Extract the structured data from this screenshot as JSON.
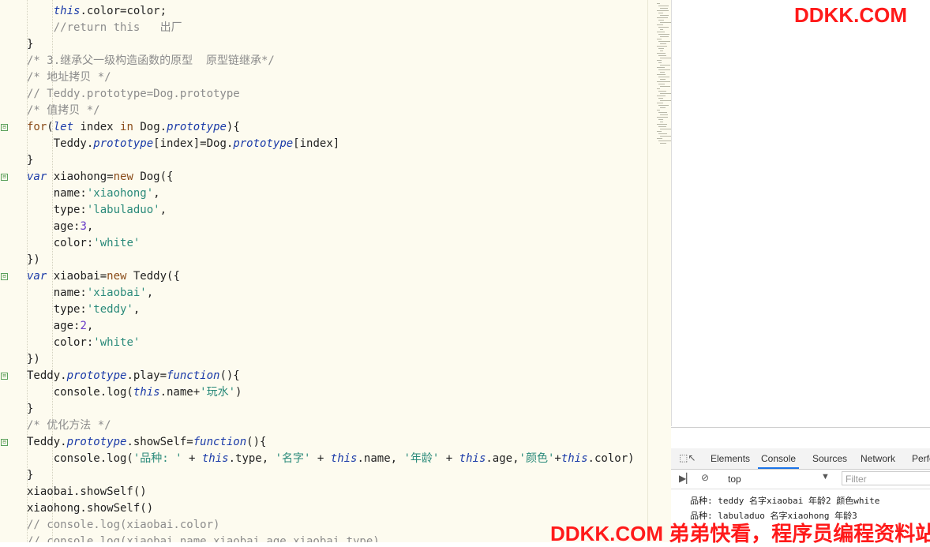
{
  "editor": {
    "lines": [
      {
        "t": [
          [
            "    ",
            ""
          ],
          [
            "this",
            "it"
          ],
          [
            ".color=color;",
            ""
          ]
        ]
      },
      {
        "t": [
          [
            "    ",
            ""
          ],
          [
            "//return this   出厂",
            "cm"
          ]
        ]
      },
      {
        "t": [
          [
            "}",
            ""
          ]
        ]
      },
      {
        "t": [
          [
            "/* 3.继承父一级构造函数的原型  原型链继承*/",
            "cm"
          ]
        ]
      },
      {
        "t": [
          [
            "/* 地址拷贝 */",
            "cm"
          ]
        ]
      },
      {
        "t": [
          [
            "// Teddy.prototype=Dog.prototype",
            "cm"
          ]
        ]
      },
      {
        "t": [
          [
            "/* 值拷贝 */",
            "cm"
          ]
        ]
      },
      {
        "t": [
          [
            "for",
            "kw"
          ],
          [
            "(",
            ""
          ],
          [
            "let",
            "it"
          ],
          [
            " index ",
            ""
          ],
          [
            "in",
            "kw"
          ],
          [
            " Dog.",
            ""
          ],
          [
            "prototype",
            "it"
          ],
          [
            "){",
            ""
          ]
        ]
      },
      {
        "t": [
          [
            "    Teddy.",
            ""
          ],
          [
            "prototype",
            "it"
          ],
          [
            "[index]=Dog.",
            ""
          ],
          [
            "prototype",
            "it"
          ],
          [
            "[index]",
            ""
          ]
        ]
      },
      {
        "t": [
          [
            "}",
            ""
          ]
        ]
      },
      {
        "t": [
          [
            "var",
            "it"
          ],
          [
            " xiaohong=",
            ""
          ],
          [
            "new",
            "kw"
          ],
          [
            " Dog({",
            ""
          ]
        ]
      },
      {
        "t": [
          [
            "    name:",
            ""
          ],
          [
            "'xiaohong'",
            "str"
          ],
          [
            ",",
            ""
          ]
        ]
      },
      {
        "t": [
          [
            "    type:",
            ""
          ],
          [
            "'labuladuo'",
            "str"
          ],
          [
            ",",
            ""
          ]
        ]
      },
      {
        "t": [
          [
            "    age:",
            ""
          ],
          [
            "3",
            "num"
          ],
          [
            ",",
            ""
          ]
        ]
      },
      {
        "t": [
          [
            "    color:",
            ""
          ],
          [
            "'white'",
            "str"
          ]
        ]
      },
      {
        "t": [
          [
            "})",
            ""
          ]
        ]
      },
      {
        "t": [
          [
            "var",
            "it"
          ],
          [
            " xiaobai=",
            ""
          ],
          [
            "new",
            "kw"
          ],
          [
            " Teddy({",
            ""
          ]
        ]
      },
      {
        "t": [
          [
            "    name:",
            ""
          ],
          [
            "'xiaobai'",
            "str"
          ],
          [
            ",",
            ""
          ]
        ]
      },
      {
        "t": [
          [
            "    type:",
            ""
          ],
          [
            "'teddy'",
            "str"
          ],
          [
            ",",
            ""
          ]
        ]
      },
      {
        "t": [
          [
            "    age:",
            ""
          ],
          [
            "2",
            "num"
          ],
          [
            ",",
            ""
          ]
        ]
      },
      {
        "t": [
          [
            "    color:",
            ""
          ],
          [
            "'white'",
            "str"
          ]
        ]
      },
      {
        "t": [
          [
            "})",
            ""
          ]
        ]
      },
      {
        "t": [
          [
            "Teddy.",
            ""
          ],
          [
            "prototype",
            "it"
          ],
          [
            ".play=",
            ""
          ],
          [
            "function",
            "it"
          ],
          [
            "(){",
            ""
          ]
        ]
      },
      {
        "t": [
          [
            "    console.log(",
            ""
          ],
          [
            "this",
            "it"
          ],
          [
            ".name+",
            ""
          ],
          [
            "'玩水'",
            "str"
          ],
          [
            ")",
            ""
          ]
        ]
      },
      {
        "t": [
          [
            "}",
            ""
          ]
        ]
      },
      {
        "t": [
          [
            "/* 优化方法 */",
            "cm"
          ]
        ]
      },
      {
        "t": [
          [
            "Teddy.",
            ""
          ],
          [
            "prototype",
            "it"
          ],
          [
            ".showSelf=",
            ""
          ],
          [
            "function",
            "it"
          ],
          [
            "(){",
            ""
          ]
        ]
      },
      {
        "t": [
          [
            "    console.log(",
            ""
          ],
          [
            "'品种: '",
            "str"
          ],
          [
            " + ",
            ""
          ],
          [
            "this",
            "it"
          ],
          [
            ".type, ",
            ""
          ],
          [
            "'名字'",
            "str"
          ],
          [
            " + ",
            ""
          ],
          [
            "this",
            "it"
          ],
          [
            ".name, ",
            ""
          ],
          [
            "'年龄'",
            "str"
          ],
          [
            " + ",
            ""
          ],
          [
            "this",
            "it"
          ],
          [
            ".age,",
            ""
          ],
          [
            "'颜色'",
            "str"
          ],
          [
            "+",
            ""
          ],
          [
            "this",
            "it"
          ],
          [
            ".color)",
            ""
          ]
        ]
      },
      {
        "t": [
          [
            "}",
            ""
          ]
        ]
      },
      {
        "t": [
          [
            "xiaobai.showSelf()",
            ""
          ]
        ]
      },
      {
        "t": [
          [
            "xiaohong.showSelf()",
            ""
          ]
        ]
      },
      {
        "t": [
          [
            "// console.log(xiaobai.color)",
            "cm"
          ]
        ]
      },
      {
        "t": [
          [
            "// console.log(xiaobai.name,xiaobai.age,xiaobai.type)",
            "cm"
          ]
        ]
      }
    ],
    "fold_markers": [
      "⊟",
      "⊟",
      "⊟",
      "⊟",
      "⊟"
    ]
  },
  "watermark_top": "DDKK.COM",
  "watermark_bottom": "DDKK.COM 弟弟快看，程序员编程资料站",
  "devtools": {
    "tabs": [
      "Elements",
      "Console",
      "Sources",
      "Network",
      "Perfo"
    ],
    "active_tab": "Console",
    "context": "top",
    "filter_placeholder": "Filter",
    "logs": [
      "品种: teddy 名字xiaobai 年龄2 颜色white",
      "品种: labuladuo 名字xiaohong 年龄3"
    ]
  },
  "colors": {
    "editor_bg": "#fdfbef",
    "watermark": "#ff1a1a",
    "keyword": "#8a4c19",
    "italic_kw": "#1a3aa8",
    "string": "#2a8a7a",
    "number": "#6a3cc8",
    "comment": "#8c8c8c"
  }
}
